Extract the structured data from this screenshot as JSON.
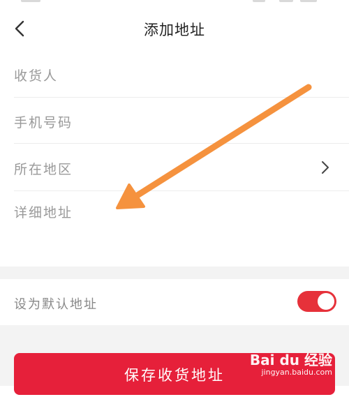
{
  "header": {
    "title": "添加地址"
  },
  "form": {
    "fields": [
      {
        "label": "收货人"
      },
      {
        "label": "手机号码"
      },
      {
        "label": "所在地区"
      },
      {
        "label": "详细地址"
      }
    ],
    "default_label": "设为默认地址",
    "default_enabled": true
  },
  "actions": {
    "save_label": "保存收货地址"
  },
  "watermark": {
    "brand": "Bai du 经验",
    "domain": "jingyan.baidu.com"
  },
  "colors": {
    "accent": "#e6203a",
    "annotation_arrow": "#f5923e",
    "background_gap": "#f3f3f3"
  },
  "icons": {
    "back": "chevron-left-icon",
    "region_next": "chevron-right-icon"
  }
}
